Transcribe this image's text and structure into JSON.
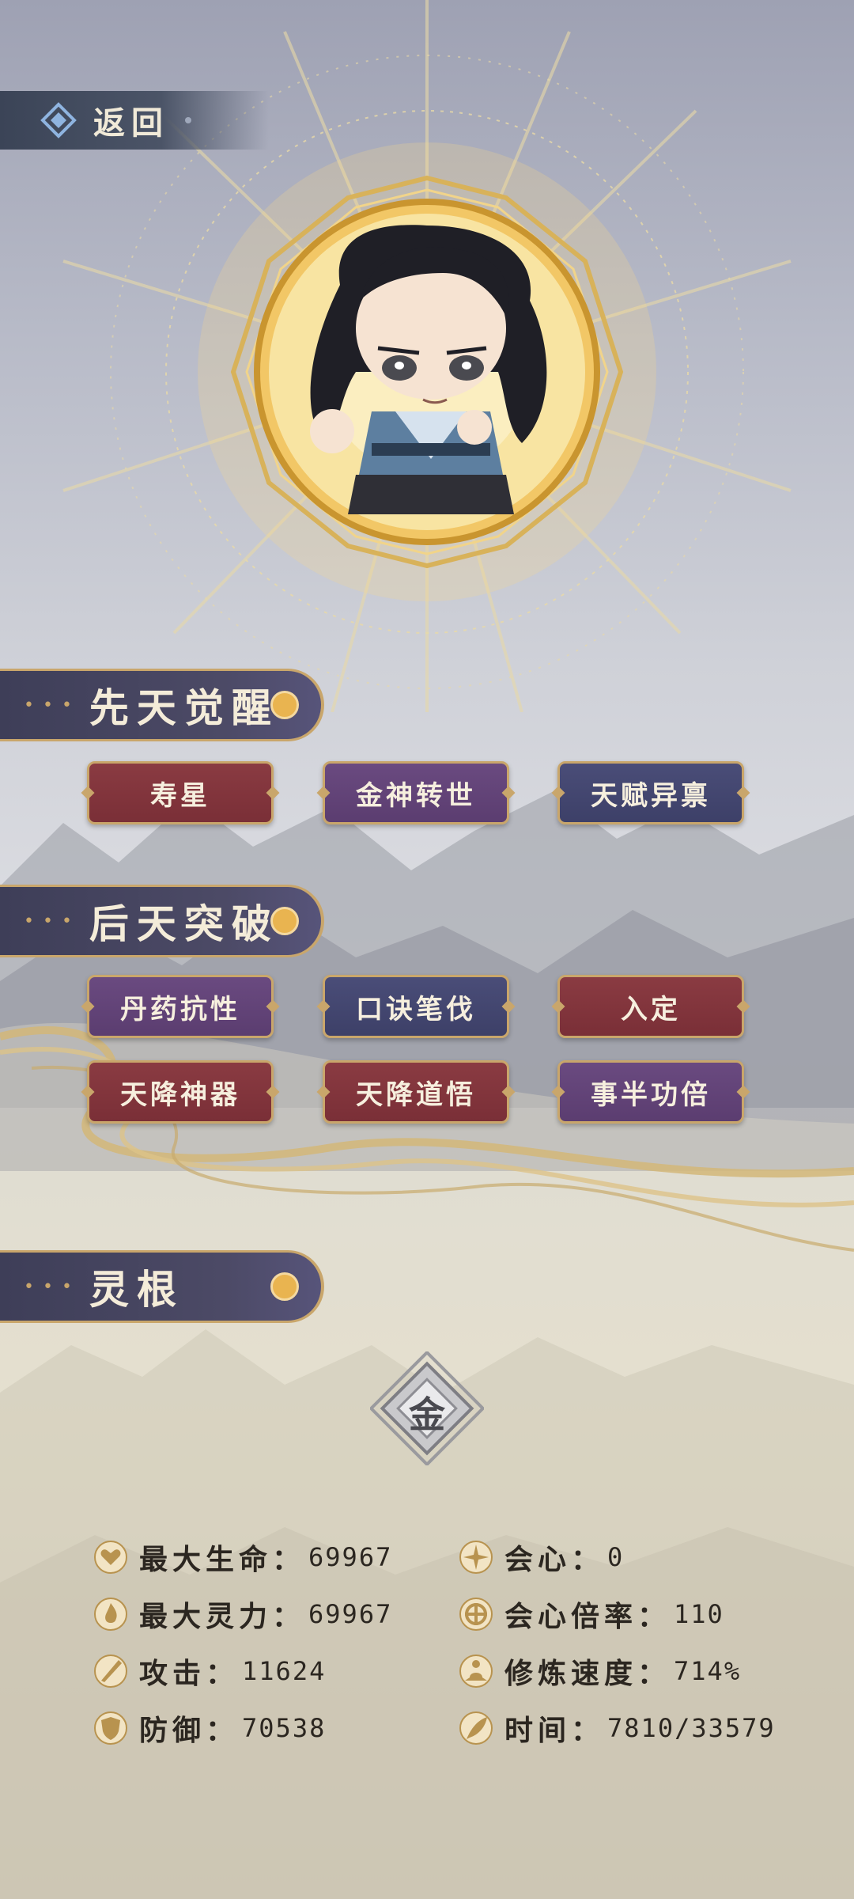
{
  "header": {
    "back_label": "返回"
  },
  "character": {
    "portrait_icon": "chibi-swordsman-icon"
  },
  "innate": {
    "title": "先天觉醒",
    "talents": [
      {
        "label": "寿星",
        "color": "red"
      },
      {
        "label": "金神转世",
        "color": "purple"
      },
      {
        "label": "天赋异禀",
        "color": "blue"
      }
    ]
  },
  "acquired": {
    "title": "后天突破",
    "talents": [
      {
        "label": "丹药抗性",
        "color": "purple"
      },
      {
        "label": "口诀笔伐",
        "color": "blue"
      },
      {
        "label": "入定",
        "color": "red"
      },
      {
        "label": "天降神器",
        "color": "red"
      },
      {
        "label": "天降道悟",
        "color": "red"
      },
      {
        "label": "事半功倍",
        "color": "purple"
      }
    ]
  },
  "spirit_root": {
    "title": "灵根",
    "element": "金"
  },
  "stats": {
    "max_hp": {
      "label": "最大生命：",
      "value": "69967"
    },
    "max_spirit": {
      "label": "最大灵力：",
      "value": "69967"
    },
    "attack": {
      "label": "攻击：",
      "value": "11624"
    },
    "defense": {
      "label": "防御：",
      "value": "70538"
    },
    "crit": {
      "label": "会心：",
      "value": "0"
    },
    "crit_rate": {
      "label": "会心倍率：",
      "value": "110"
    },
    "cultivation_speed": {
      "label": "修炼速度：",
      "value": "714%"
    },
    "time": {
      "label": "时间：",
      "value": "7810/33579"
    }
  },
  "colors": {
    "gold": "#c9a66b",
    "red": "#7a2f37",
    "purple": "#5b3d70",
    "blue": "#3d4068"
  }
}
